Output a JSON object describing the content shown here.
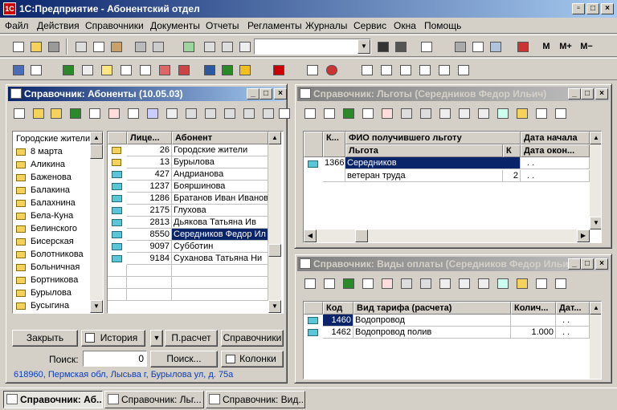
{
  "app": {
    "title": "1С:Предприятие - Абонентский отдел",
    "icon": "1c-logo-icon"
  },
  "menu": [
    "Файл",
    "Действия",
    "Справочники",
    "Документы",
    "Отчеты",
    "Регламенты",
    "Журналы",
    "Сервис",
    "Окна",
    "Помощь"
  ],
  "toolbar": {
    "m": "M",
    "mplus": "M+",
    "mminus": "M−"
  },
  "win1": {
    "title": "Справочник: Абоненты (10.05.03)",
    "tree_header": "Городские жители",
    "tree": [
      "8 марта",
      "Аликина",
      "Баженова",
      "Балакина",
      "Балахнина",
      "Бела-Куна",
      "Белинского",
      "Бисерская",
      "Болотникова",
      "Больничная",
      "Бортникова",
      "Бурылова",
      "Бусыгина"
    ],
    "col_lic": "Лице...",
    "col_ab": "Абонент",
    "rows": [
      [
        "26",
        "Городские жители"
      ],
      [
        "13",
        "Бурылова"
      ],
      [
        "427",
        "Андрианова"
      ],
      [
        "1237",
        "Бояршинова"
      ],
      [
        "1286",
        "Братанов Иван Иванович"
      ],
      [
        "2175",
        "Глухова"
      ],
      [
        "2813",
        "Дьякова Татьяна Ив"
      ],
      [
        "8550",
        "Середников Федор Ил"
      ],
      [
        "9097",
        "Субботин"
      ],
      [
        "9184",
        "Суханова Татьяна Ни"
      ]
    ],
    "btn_close": "Закрыть",
    "btn_history": "История",
    "btn_recalc": "П.расчет",
    "btn_refs": "Справочники",
    "search_label": "Поиск:",
    "search_value": "0",
    "btn_search": "Поиск...",
    "btn_columns": "Колонки",
    "address": "618960, Пермская обл, Лысьва г, Бурылова ул, д. 75а"
  },
  "win2": {
    "title": "Справочник: Льготы (Середников Федор Ильич)",
    "h_k": "К...",
    "h_fio": "ФИО получившего льготу",
    "h_start": "Дата начала",
    "h_lgota": "Льгота",
    "h_k2": "К",
    "h_end": "Дата окон...",
    "rows": [
      {
        "code": "1366",
        "name": "Середников",
        "start": ". .",
        "lgota": "ветеран труда",
        "k": "2",
        "end": ". ."
      }
    ]
  },
  "win3": {
    "title": "Справочник: Виды оплаты (Середников Федор Ильи...",
    "h_code": "Код",
    "h_vid": "Вид тарифа (расчета)",
    "h_qty": "Колич...",
    "h_date": "Дат...",
    "rows": [
      [
        "1460",
        "Водопровод",
        "",
        ". ."
      ],
      [
        "1462",
        "Водопровод полив",
        "1.000",
        ". ."
      ]
    ]
  },
  "taskbar": [
    "Справочник: Аб...",
    "Справочник: Льг...",
    "Справочник: Вид..."
  ]
}
